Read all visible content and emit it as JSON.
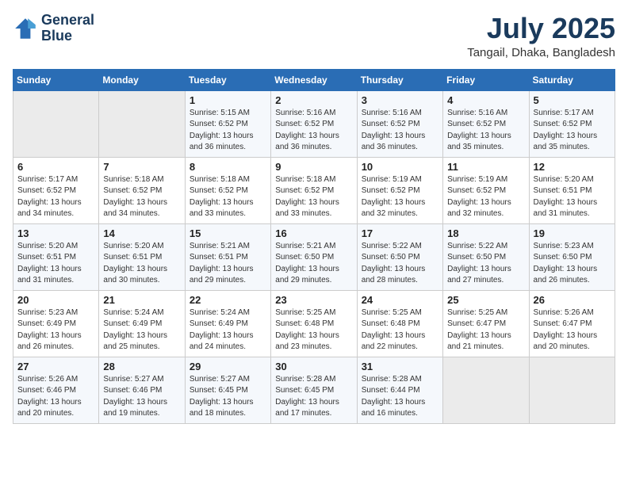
{
  "header": {
    "logo_line1": "General",
    "logo_line2": "Blue",
    "month": "July 2025",
    "location": "Tangail, Dhaka, Bangladesh"
  },
  "weekdays": [
    "Sunday",
    "Monday",
    "Tuesday",
    "Wednesday",
    "Thursday",
    "Friday",
    "Saturday"
  ],
  "weeks": [
    [
      {
        "day": "",
        "sunrise": "",
        "sunset": "",
        "daylight": ""
      },
      {
        "day": "",
        "sunrise": "",
        "sunset": "",
        "daylight": ""
      },
      {
        "day": "1",
        "sunrise": "Sunrise: 5:15 AM",
        "sunset": "Sunset: 6:52 PM",
        "daylight": "Daylight: 13 hours and 36 minutes."
      },
      {
        "day": "2",
        "sunrise": "Sunrise: 5:16 AM",
        "sunset": "Sunset: 6:52 PM",
        "daylight": "Daylight: 13 hours and 36 minutes."
      },
      {
        "day": "3",
        "sunrise": "Sunrise: 5:16 AM",
        "sunset": "Sunset: 6:52 PM",
        "daylight": "Daylight: 13 hours and 36 minutes."
      },
      {
        "day": "4",
        "sunrise": "Sunrise: 5:16 AM",
        "sunset": "Sunset: 6:52 PM",
        "daylight": "Daylight: 13 hours and 35 minutes."
      },
      {
        "day": "5",
        "sunrise": "Sunrise: 5:17 AM",
        "sunset": "Sunset: 6:52 PM",
        "daylight": "Daylight: 13 hours and 35 minutes."
      }
    ],
    [
      {
        "day": "6",
        "sunrise": "Sunrise: 5:17 AM",
        "sunset": "Sunset: 6:52 PM",
        "daylight": "Daylight: 13 hours and 34 minutes."
      },
      {
        "day": "7",
        "sunrise": "Sunrise: 5:18 AM",
        "sunset": "Sunset: 6:52 PM",
        "daylight": "Daylight: 13 hours and 34 minutes."
      },
      {
        "day": "8",
        "sunrise": "Sunrise: 5:18 AM",
        "sunset": "Sunset: 6:52 PM",
        "daylight": "Daylight: 13 hours and 33 minutes."
      },
      {
        "day": "9",
        "sunrise": "Sunrise: 5:18 AM",
        "sunset": "Sunset: 6:52 PM",
        "daylight": "Daylight: 13 hours and 33 minutes."
      },
      {
        "day": "10",
        "sunrise": "Sunrise: 5:19 AM",
        "sunset": "Sunset: 6:52 PM",
        "daylight": "Daylight: 13 hours and 32 minutes."
      },
      {
        "day": "11",
        "sunrise": "Sunrise: 5:19 AM",
        "sunset": "Sunset: 6:52 PM",
        "daylight": "Daylight: 13 hours and 32 minutes."
      },
      {
        "day": "12",
        "sunrise": "Sunrise: 5:20 AM",
        "sunset": "Sunset: 6:51 PM",
        "daylight": "Daylight: 13 hours and 31 minutes."
      }
    ],
    [
      {
        "day": "13",
        "sunrise": "Sunrise: 5:20 AM",
        "sunset": "Sunset: 6:51 PM",
        "daylight": "Daylight: 13 hours and 31 minutes."
      },
      {
        "day": "14",
        "sunrise": "Sunrise: 5:20 AM",
        "sunset": "Sunset: 6:51 PM",
        "daylight": "Daylight: 13 hours and 30 minutes."
      },
      {
        "day": "15",
        "sunrise": "Sunrise: 5:21 AM",
        "sunset": "Sunset: 6:51 PM",
        "daylight": "Daylight: 13 hours and 29 minutes."
      },
      {
        "day": "16",
        "sunrise": "Sunrise: 5:21 AM",
        "sunset": "Sunset: 6:50 PM",
        "daylight": "Daylight: 13 hours and 29 minutes."
      },
      {
        "day": "17",
        "sunrise": "Sunrise: 5:22 AM",
        "sunset": "Sunset: 6:50 PM",
        "daylight": "Daylight: 13 hours and 28 minutes."
      },
      {
        "day": "18",
        "sunrise": "Sunrise: 5:22 AM",
        "sunset": "Sunset: 6:50 PM",
        "daylight": "Daylight: 13 hours and 27 minutes."
      },
      {
        "day": "19",
        "sunrise": "Sunrise: 5:23 AM",
        "sunset": "Sunset: 6:50 PM",
        "daylight": "Daylight: 13 hours and 26 minutes."
      }
    ],
    [
      {
        "day": "20",
        "sunrise": "Sunrise: 5:23 AM",
        "sunset": "Sunset: 6:49 PM",
        "daylight": "Daylight: 13 hours and 26 minutes."
      },
      {
        "day": "21",
        "sunrise": "Sunrise: 5:24 AM",
        "sunset": "Sunset: 6:49 PM",
        "daylight": "Daylight: 13 hours and 25 minutes."
      },
      {
        "day": "22",
        "sunrise": "Sunrise: 5:24 AM",
        "sunset": "Sunset: 6:49 PM",
        "daylight": "Daylight: 13 hours and 24 minutes."
      },
      {
        "day": "23",
        "sunrise": "Sunrise: 5:25 AM",
        "sunset": "Sunset: 6:48 PM",
        "daylight": "Daylight: 13 hours and 23 minutes."
      },
      {
        "day": "24",
        "sunrise": "Sunrise: 5:25 AM",
        "sunset": "Sunset: 6:48 PM",
        "daylight": "Daylight: 13 hours and 22 minutes."
      },
      {
        "day": "25",
        "sunrise": "Sunrise: 5:25 AM",
        "sunset": "Sunset: 6:47 PM",
        "daylight": "Daylight: 13 hours and 21 minutes."
      },
      {
        "day": "26",
        "sunrise": "Sunrise: 5:26 AM",
        "sunset": "Sunset: 6:47 PM",
        "daylight": "Daylight: 13 hours and 20 minutes."
      }
    ],
    [
      {
        "day": "27",
        "sunrise": "Sunrise: 5:26 AM",
        "sunset": "Sunset: 6:46 PM",
        "daylight": "Daylight: 13 hours and 20 minutes."
      },
      {
        "day": "28",
        "sunrise": "Sunrise: 5:27 AM",
        "sunset": "Sunset: 6:46 PM",
        "daylight": "Daylight: 13 hours and 19 minutes."
      },
      {
        "day": "29",
        "sunrise": "Sunrise: 5:27 AM",
        "sunset": "Sunset: 6:45 PM",
        "daylight": "Daylight: 13 hours and 18 minutes."
      },
      {
        "day": "30",
        "sunrise": "Sunrise: 5:28 AM",
        "sunset": "Sunset: 6:45 PM",
        "daylight": "Daylight: 13 hours and 17 minutes."
      },
      {
        "day": "31",
        "sunrise": "Sunrise: 5:28 AM",
        "sunset": "Sunset: 6:44 PM",
        "daylight": "Daylight: 13 hours and 16 minutes."
      },
      {
        "day": "",
        "sunrise": "",
        "sunset": "",
        "daylight": ""
      },
      {
        "day": "",
        "sunrise": "",
        "sunset": "",
        "daylight": ""
      }
    ]
  ]
}
